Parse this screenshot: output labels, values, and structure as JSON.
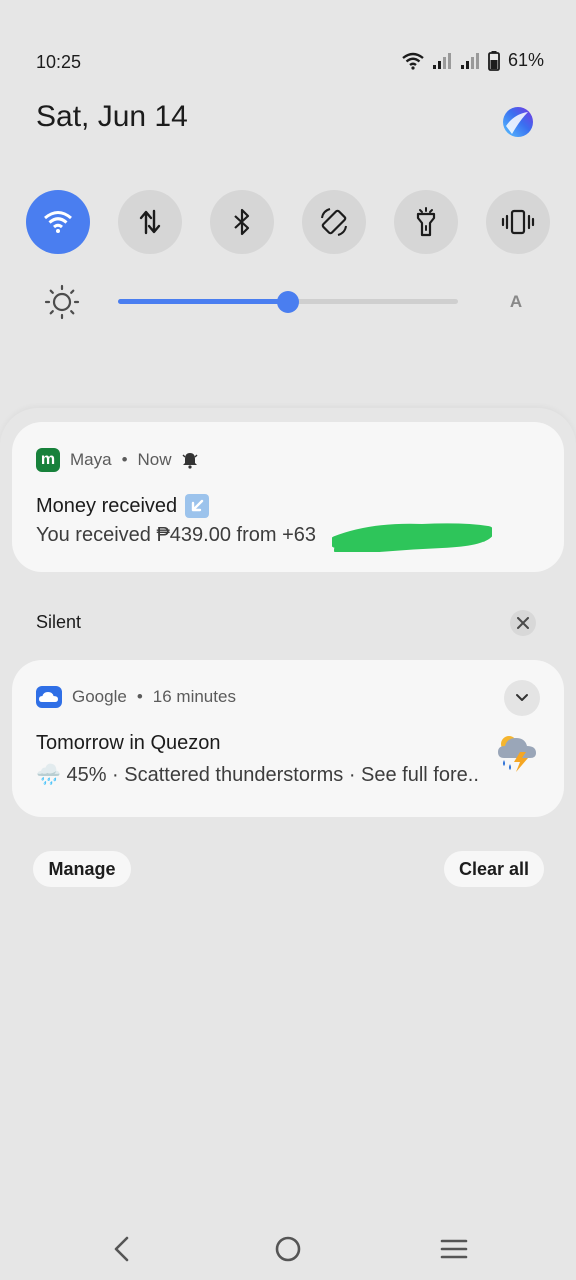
{
  "status_bar": {
    "time": "10:25",
    "battery": "61%"
  },
  "header": {
    "date": "Sat, Jun 14"
  },
  "quick_settings": [
    {
      "name": "wifi",
      "active": true
    },
    {
      "name": "mobile-data",
      "active": false
    },
    {
      "name": "bluetooth",
      "active": false
    },
    {
      "name": "auto-rotate",
      "active": false
    },
    {
      "name": "flashlight",
      "active": false
    },
    {
      "name": "vibrate",
      "active": false
    }
  ],
  "brightness": {
    "level": 0.5,
    "auto_label": "A"
  },
  "notifications": {
    "maya": {
      "app": "Maya",
      "time": "Now",
      "title": "Money received",
      "text": "You received ₱439.00 from +63"
    },
    "silent_section": {
      "label": "Silent"
    },
    "google": {
      "app": "Google",
      "time": "16 minutes",
      "title": "Tomorrow in Quezon",
      "text": "🌧️ 45% · Scattered thunderstorms · See full fore.."
    }
  },
  "actions": {
    "manage": "Manage",
    "clear_all": "Clear all"
  },
  "colors": {
    "accent": "#4a7ef0",
    "background": "#e6e6e6",
    "card": "#f7f7f7",
    "maya_green": "#17813b",
    "redaction": "#2ec55a"
  }
}
